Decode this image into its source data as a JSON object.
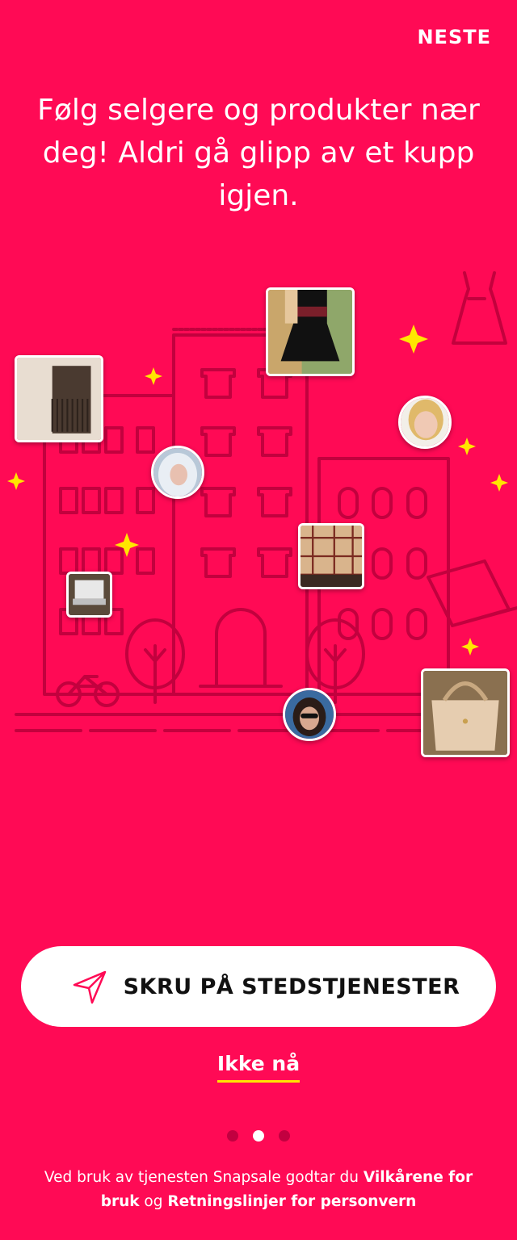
{
  "header": {
    "next_label": "NESTE"
  },
  "headline": "Følg selgere og produkter nær deg! Aldri gå glipp av et kupp igjen.",
  "cta": {
    "label": "SKRU PÅ STEDSTJENESTER",
    "icon": "location-arrow-icon"
  },
  "skip_label": "Ikke nå",
  "pagination": {
    "total": 3,
    "active": 2
  },
  "terms": {
    "prefix": "Ved bruk av tjenesten Snapsale godtar du ",
    "terms_link": "Vilkårene for bruk",
    "middle": " og ",
    "privacy_link": "Retningslinjer for personvern"
  },
  "colors": {
    "background": "#ff0a55",
    "accent_underline": "#ffe600",
    "sparkle": "#ffe600"
  }
}
